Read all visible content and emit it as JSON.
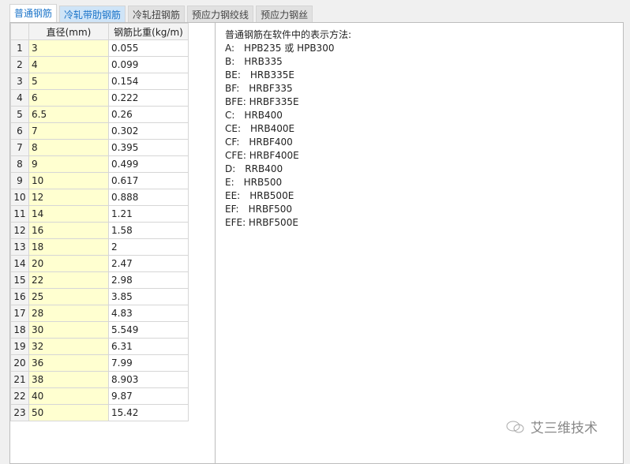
{
  "tabs": [
    "普通钢筋",
    "冷轧带肋钢筋",
    "冷轧扭钢筋",
    "预应力钢绞线",
    "预应力钢丝"
  ],
  "table": {
    "headers": [
      "",
      "直径(mm)",
      "钢筋比重(kg/m)"
    ],
    "rows": [
      [
        "1",
        "3",
        "0.055"
      ],
      [
        "2",
        "4",
        "0.099"
      ],
      [
        "3",
        "5",
        "0.154"
      ],
      [
        "4",
        "6",
        "0.222"
      ],
      [
        "5",
        "6.5",
        "0.26"
      ],
      [
        "6",
        "7",
        "0.302"
      ],
      [
        "7",
        "8",
        "0.395"
      ],
      [
        "8",
        "9",
        "0.499"
      ],
      [
        "9",
        "10",
        "0.617"
      ],
      [
        "10",
        "12",
        "0.888"
      ],
      [
        "11",
        "14",
        "1.21"
      ],
      [
        "12",
        "16",
        "1.58"
      ],
      [
        "13",
        "18",
        "2"
      ],
      [
        "14",
        "20",
        "2.47"
      ],
      [
        "15",
        "22",
        "2.98"
      ],
      [
        "16",
        "25",
        "3.85"
      ],
      [
        "17",
        "28",
        "4.83"
      ],
      [
        "18",
        "30",
        "5.549"
      ],
      [
        "19",
        "32",
        "6.31"
      ],
      [
        "20",
        "36",
        "7.99"
      ],
      [
        "21",
        "38",
        "8.903"
      ],
      [
        "22",
        "40",
        "9.87"
      ],
      [
        "23",
        "50",
        "15.42"
      ]
    ]
  },
  "notes": [
    "普通钢筋在软件中的表示方法:",
    "A:　HPB235 或 HPB300",
    "B:　HRB335",
    "BE:　HRB335E",
    "BF:　HRBF335",
    "BFE: HRBF335E",
    "C:　HRB400",
    "CE:　HRB400E",
    "CF:　HRBF400",
    "CFE: HRBF400E",
    "D:　RRB400",
    "E:　HRB500",
    "EE:　HRB500E",
    "EF:　HRBF500",
    "EFE: HRBF500E"
  ],
  "watermark": "艾三维技术"
}
